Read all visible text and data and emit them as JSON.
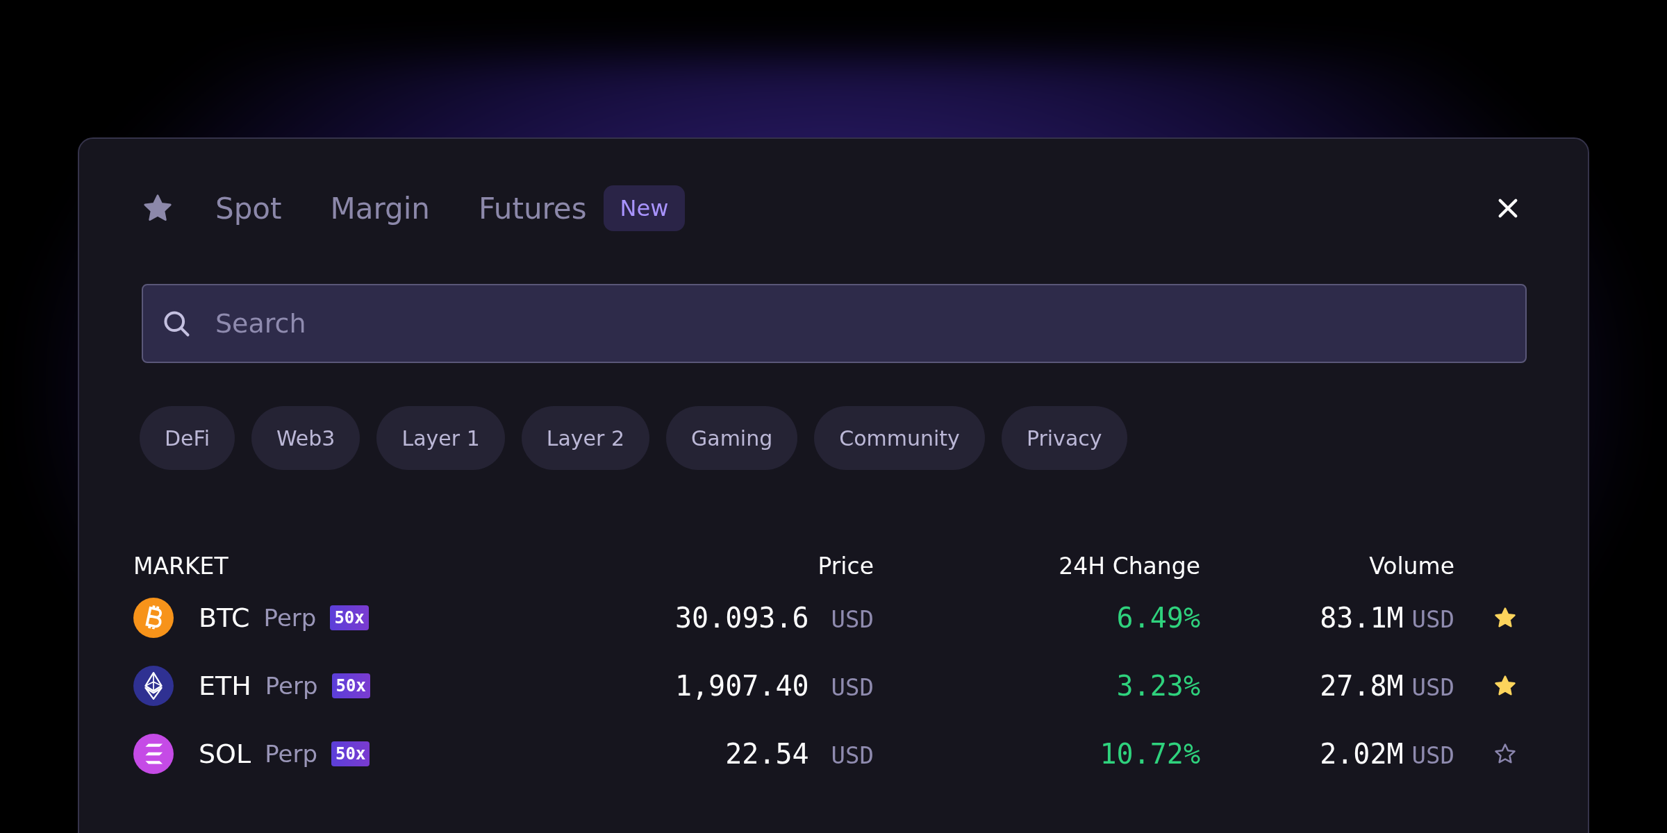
{
  "tabs": [
    {
      "kind": "favorites",
      "selected": false
    },
    {
      "kind": "text",
      "label": "Spot",
      "selected": false
    },
    {
      "kind": "text",
      "label": "Margin",
      "selected": false
    },
    {
      "kind": "text",
      "label": "Futures",
      "badge": "New",
      "selected": false
    }
  ],
  "search": {
    "placeholder": "Search"
  },
  "categories": [
    "DeFi",
    "Web3",
    "Layer 1",
    "Layer 2",
    "Gaming",
    "Community",
    "Privacy"
  ],
  "table": {
    "columns": [
      "MARKET",
      "Price",
      "24H Change",
      "Volume"
    ],
    "rows": [
      {
        "kind": "bitcoin",
        "color": "#f7931a",
        "symbol": "BTC",
        "type": "Perp",
        "leverage": "50x",
        "price": "30.093.6",
        "price_unit": "USD",
        "change": "6.49%",
        "volume": "83.1M",
        "volume_unit": "USD",
        "favorite": true
      },
      {
        "kind": "ether",
        "color": "#2f3192",
        "symbol": "ETH",
        "type": "Perp",
        "leverage": "50x",
        "price": "1,907.40",
        "price_unit": "USD",
        "change": "3.23%",
        "volume": "27.8M",
        "volume_unit": "USD",
        "favorite": true
      },
      {
        "kind": "solana",
        "color": "#c54be6",
        "symbol": "SOL",
        "type": "Perp",
        "leverage": "50x",
        "price": "22.54",
        "price_unit": "USD",
        "change": "10.72%",
        "volume": "2.02M",
        "volume_unit": "USD",
        "favorite": false
      }
    ]
  }
}
